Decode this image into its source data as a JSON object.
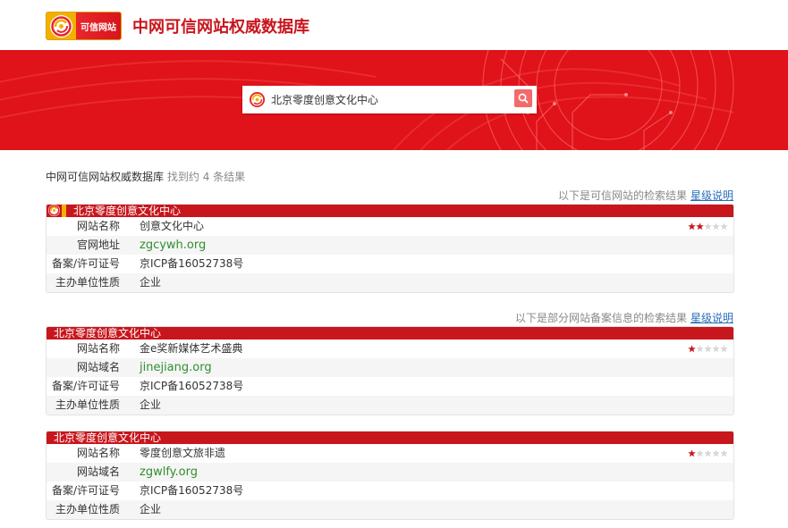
{
  "header": {
    "logo_text": "可信网站",
    "title": "中网可信网站权威数据库"
  },
  "search": {
    "value": "北京零度创意文化中心"
  },
  "summary": {
    "source": "中网可信网站权威数据库",
    "found_prefix": "找到约",
    "count": "4",
    "found_suffix": "条结果"
  },
  "notices": [
    {
      "text": "以下是可信网站的检索结果",
      "link": "星级说明"
    },
    {
      "text": "以下是部分网站备案信息的检索结果",
      "link": "星级说明"
    }
  ],
  "colors": {
    "brand_red": "#c8161d",
    "banner_red": "#e0121a",
    "link_green": "#2f8f2f",
    "link_blue": "#2a6ebb",
    "star_red": "#c8161d",
    "star_empty": "#d6d6d6"
  },
  "cards": [
    {
      "title": "北京零度创意文化中心",
      "rows": [
        {
          "key": "网站名称",
          "value": "创意文化中心",
          "rating": 2
        },
        {
          "key": "官网地址",
          "value": "zgcywh.org"
        },
        {
          "key": "备案/许可证号",
          "value": "京ICP备16052738号"
        },
        {
          "key": "主办单位性质",
          "value": "企业"
        }
      ]
    },
    {
      "title": "北京零度创意文化中心",
      "rows": [
        {
          "key": "网站名称",
          "value": "金e奖新媒体艺术盛典",
          "rating": 1
        },
        {
          "key": "网站域名",
          "value": "jinejiang.org"
        },
        {
          "key": "备案/许可证号",
          "value": "京ICP备16052738号"
        },
        {
          "key": "主办单位性质",
          "value": "企业"
        }
      ]
    },
    {
      "title": "北京零度创意文化中心",
      "rows": [
        {
          "key": "网站名称",
          "value": "零度创意文旅非遗",
          "rating": 1
        },
        {
          "key": "网站域名",
          "value": "zgwlfy.org"
        },
        {
          "key": "备案/许可证号",
          "value": "京ICP备16052738号"
        },
        {
          "key": "主办单位性质",
          "value": "企业"
        }
      ]
    }
  ],
  "rating_max": 5
}
